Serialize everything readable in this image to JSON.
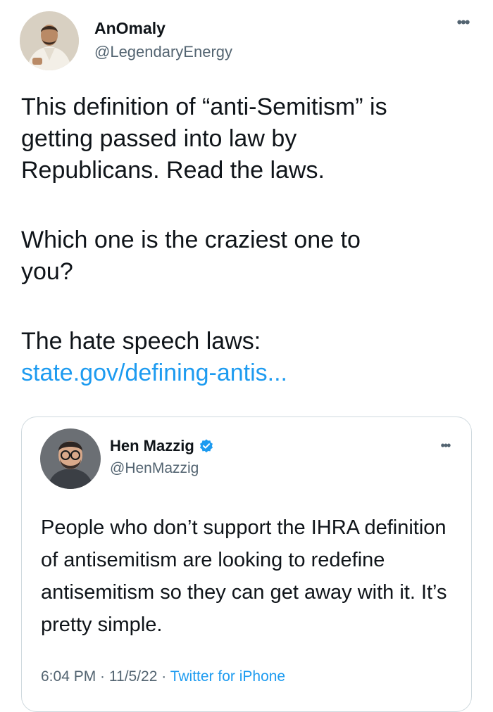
{
  "tweet": {
    "author": {
      "name": "AnOmaly",
      "handle": "@LegendaryEnergy"
    },
    "more_label": "•••",
    "text": {
      "para1": "This definition of “anti-Semitism” is\ngetting passed into law by\nRepublicans. Read the laws.",
      "para2": "Which one is the craziest one to\nyou?",
      "para3": "The hate speech laws:",
      "link": "state.gov/defining-antis..."
    }
  },
  "quoted_tweet": {
    "author": {
      "name": "Hen Mazzig",
      "handle": "@HenMazzig",
      "verified": true
    },
    "more_label": "•••",
    "text": "People who don’t support the IHRA definition of antisemitism are looking to redefine antisemitism so they can get away with it. It’s pretty simple.",
    "meta": {
      "time": "6:04 PM",
      "separator": " · ",
      "date": "11/5/22",
      "source": "Twitter for iPhone"
    }
  },
  "colors": {
    "link": "#1d9bf0",
    "secondary_text": "#536471",
    "border": "#cfd9de",
    "verified": "#1d9bf0"
  },
  "icons": [
    "more-icon",
    "verified-badge-icon"
  ]
}
